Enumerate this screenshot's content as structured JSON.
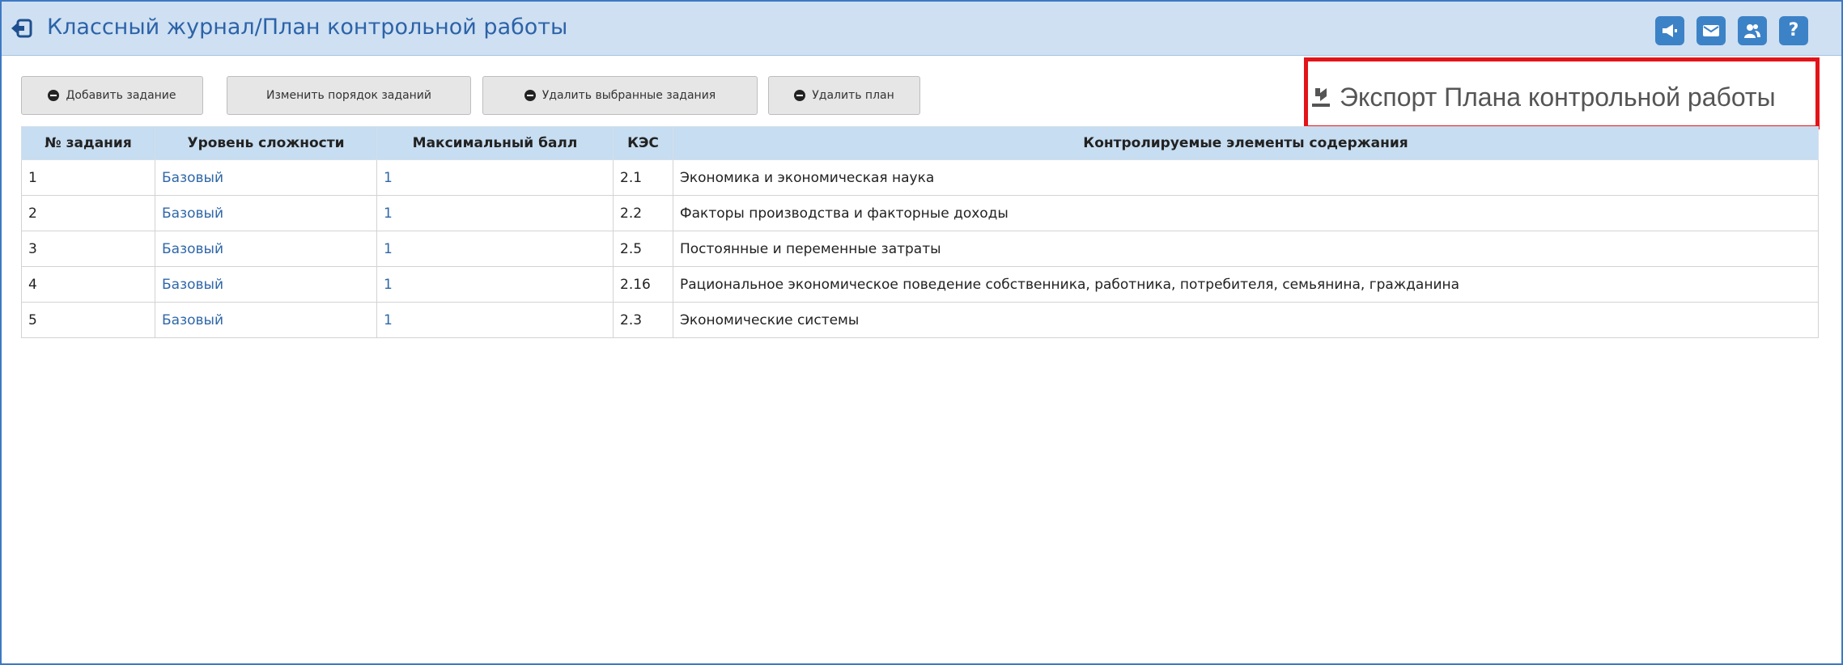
{
  "window": {
    "title": "Классный журнал/План контрольной работы",
    "icons": [
      "back-icon",
      "megaphone-icon",
      "mail-icon",
      "users-icon",
      "help-icon"
    ],
    "help_label": "?",
    "accent_color": "#3c82c7",
    "titlebar_color": "#cfe0f2"
  },
  "toolbar": {
    "add_task": "Добавить задание",
    "reorder_tasks": "Изменить порядок заданий",
    "delete_selected": "Удалить выбранные задания",
    "delete_plan": "Удалить план"
  },
  "export": {
    "label": "Экспорт Плана контрольной работы",
    "icon": "download-icon",
    "highlight_color": "#e3131a"
  },
  "table": {
    "columns": [
      "№ задания",
      "Уровень сложности",
      "Максимальный балл",
      "КЭС",
      "Контролируемые элементы содержания"
    ],
    "rows": [
      {
        "num": "1",
        "level": "Базовый",
        "score": "1",
        "kes": "2.1",
        "element": "Экономика и экономическая наука"
      },
      {
        "num": "2",
        "level": "Базовый",
        "score": "1",
        "kes": "2.2",
        "element": "Факторы производства и факторные доходы"
      },
      {
        "num": "3",
        "level": "Базовый",
        "score": "1",
        "kes": "2.5",
        "element": "Постоянные и переменные затраты"
      },
      {
        "num": "4",
        "level": "Базовый",
        "score": "1",
        "kes": "2.16",
        "element": "Рациональное экономическое поведение собственника, работника, потребителя, семьянина, гражданина"
      },
      {
        "num": "5",
        "level": "Базовый",
        "score": "1",
        "kes": "2.3",
        "element": "Экономические системы"
      }
    ]
  }
}
